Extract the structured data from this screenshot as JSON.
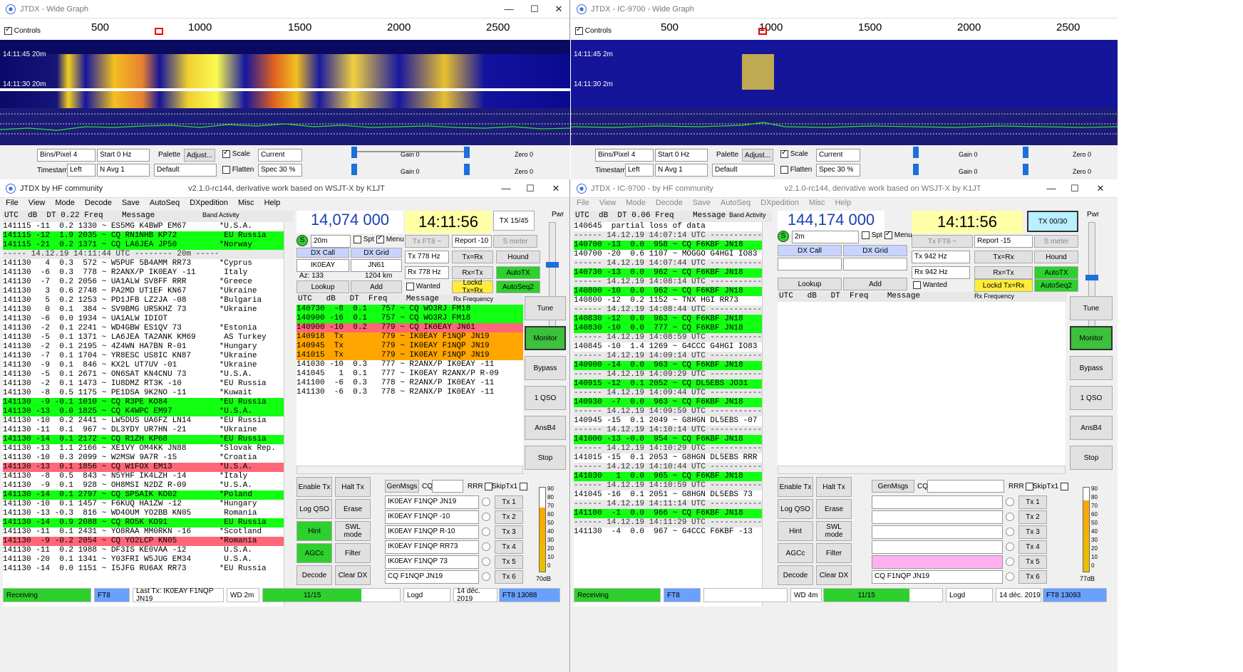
{
  "left_graph": {
    "title": "JTDX - Wide Graph",
    "controls_label": "Controls",
    "scale": [
      "500",
      "1000",
      "1500",
      "2000",
      "2500"
    ],
    "ts1": "14:11:45  20m",
    "ts2": "14:11:30  20m",
    "bins_label": "Bins/Pixel",
    "bins_val": "4",
    "start_val": "Start 0 Hz",
    "palette": "Palette",
    "adjust": "Adjust...",
    "scale_cb": "Scale",
    "current": "Current",
    "gain1": "Gain 0",
    "zero1": "Zero 0",
    "timestamp": "Timestamp",
    "left": "Left",
    "navg": "N Avg 1",
    "default": "Default",
    "flatten": "Flatten",
    "spec": "Spec 30 %",
    "gain2": "Gain 0",
    "zero2": "Zero 0"
  },
  "right_graph": {
    "title": "JTDX - IC-9700 - Wide Graph",
    "controls_label": "Controls",
    "scale": [
      "500",
      "1000",
      "1500",
      "2000",
      "2500"
    ],
    "ts1": "14:11:45  2m",
    "ts2": "14:11:30  2m",
    "bins_label": "Bins/Pixel",
    "bins_val": "4",
    "start_val": "Start 0 Hz",
    "palette": "Palette",
    "adjust": "Adjust...",
    "scale_cb": "Scale",
    "current": "Current",
    "gain1": "Gain 0",
    "zero1": "Zero 0",
    "timestamp": "Timestamp",
    "left": "Left",
    "navg": "N Avg 1",
    "default": "Default",
    "flatten": "Flatten",
    "spec": "Spec 30 %",
    "gain2": "Gain 0",
    "zero2": "Zero 0"
  },
  "left_main": {
    "title": "JTDX  by HF community",
    "subtitle": "v2.1.0-rc144, derivative work based on WSJT-X by K1JT",
    "menu": [
      "File",
      "View",
      "Mode",
      "Decode",
      "Save",
      "AutoSeq",
      "DXpedition",
      "Misc",
      "Help"
    ],
    "band_header": "UTC  dB  DT 0.22 Freq    Message",
    "band_activity": "Band Activity",
    "band_rows": [
      {
        "t": "141115 -11  0.2 1330 ~ ES5MG K4BWP EM67       *U.S.A.",
        "c": ""
      },
      {
        "t": "141115 -12  1.9 2035 ~ CQ RN1NHB KP72          EU Russia",
        "c": "g"
      },
      {
        "t": "141115 -21  0.2 1371 ~ CQ LA6JEA JP50         *Norway",
        "c": "g"
      },
      {
        "t": "----- 14.12.19 14:11:44 UTC -------- 20m -----",
        "c": "h"
      },
      {
        "t": "141130   4  0.3  572 ~ W5PUF 5B4AMM RR73      *Cyprus",
        "c": ""
      },
      {
        "t": "141130  -6  0.3  778 ~ R2ANX/P IK0EAY -11      Italy",
        "c": ""
      },
      {
        "t": "141130  -7  0.2 2056 ~ UA1ALW SV8FF RRR       *Greece",
        "c": ""
      },
      {
        "t": "141130   3  0.6 2748 ~ PA2MD UT1EF KN67       *Ukraine",
        "c": ""
      },
      {
        "t": "141130   5  0.2 1253 ~ PD1JFB LZ2JA -08       *Bulgaria",
        "c": ""
      },
      {
        "t": "141130   0  0.1  384 ~ SV9BMG UR5KHZ 73       *Ukraine",
        "c": ""
      },
      {
        "t": "141130  -6  0.0 1934 ~ UA1ALW IDIOT",
        "c": ""
      },
      {
        "t": "141130  -2  0.1 2241 ~ WD4GBW ES1QV 73        *Estonia",
        "c": ""
      },
      {
        "t": "141130  -5  0.1 1371 ~ LA6JEA TA2ANK KM69      AS Turkey",
        "c": ""
      },
      {
        "t": "141130  -2  0.1 2195 ~ 4Z4WN HA7BN R-01       *Hungary",
        "c": ""
      },
      {
        "t": "141130  -7  0.1 1704 ~ YR8ESC US8IC KN87      *Ukraine",
        "c": ""
      },
      {
        "t": "141130  -9  0.1  846 ~ KX2L UT7UV -01         *Ukraine",
        "c": ""
      },
      {
        "t": "141130  -5  0.1 2671 ~ ON6SAT KN4CNU 73       *U.S.A.",
        "c": ""
      },
      {
        "t": "141130  -2  0.1 1473 ~ IU8DMZ RT3K -10        *EU Russia",
        "c": ""
      },
      {
        "t": "141130  -8  0.5 1175 ~ PE1DSA 9K2NO -11       *Kuwait",
        "c": ""
      },
      {
        "t": "141130  -9 -0.1 1010 ~ CQ R3PE KO84           *EU Russia",
        "c": "g"
      },
      {
        "t": "141130 -13  0.0 1825 ~ CQ K4WPC EM97          *U.S.A.",
        "c": "g"
      },
      {
        "t": "141130 -10  0.2 2441 ~ LW5DUS UA6FZ LN14      *EU Russia",
        "c": ""
      },
      {
        "t": "141130 -11  0.1  967 ~ DL3YDY UR7HN -21       *Ukraine",
        "c": ""
      },
      {
        "t": "141130 -14  0.1 2172 ~ CQ R1ZH KP68           *EU Russia",
        "c": "g"
      },
      {
        "t": "141130 -13  1.1 2166 ~ XE1VY OM4KK JN88       *Slovak Rep.",
        "c": ""
      },
      {
        "t": "141130 -10  0.3 2099 ~ W2MSW 9A7R -15         *Croatia",
        "c": ""
      },
      {
        "t": "141130 -13  0.1 1856 ~ CQ W1FOX EM13          *U.S.A.",
        "c": "r"
      },
      {
        "t": "141130  -8  0.5  843 ~ N5YHF IK4LZH -14       *Italy",
        "c": ""
      },
      {
        "t": "141130  -9  0.1  928 ~ OH8MSI N2DZ R-09       *U.S.A.",
        "c": ""
      },
      {
        "t": "141130 -14  0.1 2797 ~ CQ SP5AIK KO02         *Poland",
        "c": "g"
      },
      {
        "t": "141130 -10  0.1 1457 ~ F6KUQ HA1ZW -12        *Hungary",
        "c": ""
      },
      {
        "t": "141130 -13 -0.3  816 ~ WD4OUM YO2BB KN05       Romania",
        "c": ""
      },
      {
        "t": "141130 -14  0.9 2088 ~ CQ RO5K KO91            EU Russia",
        "c": "g"
      },
      {
        "t": "141130 -11  0.1 2431 ~ YO8RAA MM0RKN -16      *Scotland",
        "c": ""
      },
      {
        "t": "141130  -9 -0.2 2054 ~ CQ YO2LCP KN05         *Romania",
        "c": "r"
      },
      {
        "t": "141130 -11  0.2 1988 ~ DF3IS KE0VAA -12        U.S.A.",
        "c": ""
      },
      {
        "t": "141130 -20  0.1 1341 ~ Y03FRI W5JUG EM34       U.S.A.",
        "c": ""
      },
      {
        "t": "141130 -14  0.0 1151 ~ I5JFG RU6AX RR73       *EU Russia",
        "c": ""
      }
    ],
    "freq": "14,074 000",
    "clock": "14:11:56",
    "tx_label": "TX 15/45",
    "band": "20m",
    "spt": "Spt",
    "menu_cb": "Menu",
    "tx_ft8": "Tx FT8 ~",
    "report": "Report -10",
    "smeter": "S meter",
    "dxcall_lbl": "DX Call",
    "dxgrid_lbl": "DX Grid",
    "dxcall": "IK0EAY",
    "dxgrid": "JN61",
    "tx_hz": "Tx  778 Hz",
    "txrx": "Tx=Rx",
    "hound": "Hound",
    "az": "Az: 133",
    "km": "1204 km",
    "rx_hz": "Rx  778 Hz",
    "rxtx": "Rx=Tx",
    "autotx": "AutoTX",
    "lookup": "Lookup",
    "add": "Add",
    "wanted": "Wanted",
    "lockd": "Lockd Tx=Rx",
    "autoseq2": "AutoSeq2",
    "pwr": "Pwr",
    "rx_header": "UTC   dB   DT  Freq    Message",
    "rx_freq_lbl": "Rx Frequency",
    "rx_rows": [
      {
        "t": "140730  -8  0.1   757 ~ CQ WO3RJ FM18",
        "c": "g"
      },
      {
        "t": "140900 -16  0.1   757 ~ CQ WO3RJ FM18",
        "c": "g"
      },
      {
        "t": "140900 -10  0.2   779 ~ CQ IK0EAY JN61",
        "c": "r"
      },
      {
        "t": "140918  Tx        779 ~ IK0EAY F1NQP JN19",
        "c": "o"
      },
      {
        "t": "140945  Tx        779 ~ IK0EAY F1NQP JN19",
        "c": "o"
      },
      {
        "t": "141015  Tx        779 ~ IK0EAY F1NQP JN19",
        "c": "o"
      },
      {
        "t": "141030 -10  0.3   777 ~ R2ANX/P IK0EAY -11",
        "c": ""
      },
      {
        "t": "141045   1  0.1   777 ~ IK0EAY R2ANX/P R-09",
        "c": ""
      },
      {
        "t": "141100  -6  0.3   778 ~ R2ANX/P IK0EAY -11",
        "c": ""
      },
      {
        "t": "141130  -6  0.3   778 ~ R2ANX/P IK0EAY -11",
        "c": ""
      }
    ],
    "side_btns": [
      "Tune",
      "Monitor",
      "Bypass",
      "1 QSO",
      "AnsB4",
      "Stop"
    ],
    "bottom_btns": [
      "Enable Tx",
      "Halt Tx",
      "Log QSO",
      "Erase",
      "Hint",
      "SWL mode",
      "AGCc",
      "Filter",
      "Decode",
      "Clear DX"
    ],
    "genmsgs": "GenMsgs",
    "cq": "CQ",
    "rrr": "RRR",
    "skiptx1": "SkipTx1",
    "msgs": [
      "IK0EAY F1NQP JN19",
      "IK0EAY F1NQP -10",
      "IK0EAY F1NQP R-10",
      "IK0EAY F1NQP RR73",
      "IK0EAY F1NQP 73",
      "CQ F1NQP JN19"
    ],
    "tx_btns": [
      "Tx 1",
      "Tx 2",
      "Tx 3",
      "Tx 4",
      "Tx 5",
      "Tx 6"
    ],
    "meter_ticks": [
      "90",
      "80",
      "70",
      "60",
      "50",
      "40",
      "30",
      "20",
      "10",
      "0"
    ],
    "meter_db": "70dB",
    "status": {
      "receiving": "Receiving",
      "mode": "FT8",
      "last_tx": "Last Tx: IK0EAY F1NQP JN19",
      "wd": "WD 2m",
      "progress": "11/15",
      "logd": "Logd",
      "date": "14 déc. 2019",
      "ft8n": "FT8  13088"
    }
  },
  "right_main": {
    "title": "JTDX - IC-9700 - by HF community",
    "subtitle": "v2.1.0-rc144, derivative work based on WSJT-X by K1JT",
    "menu": [
      "File",
      "View",
      "Mode",
      "Decode",
      "Save",
      "AutoSeq",
      "DXpedition",
      "Misc",
      "Help"
    ],
    "band_header": "UTC  dB  DT 0.06 Freq    Message",
    "band_activity": "Band Activity",
    "band_rows": [
      {
        "t": "140645  partial loss of data",
        "c": ""
      },
      {
        "t": "------ 14.12.19 14:07:14 UTC -----------",
        "c": "h"
      },
      {
        "t": "140700 -13  0.0  958 ~ CQ F6KBF JN18",
        "c": "g"
      },
      {
        "t": "140700 -20  0.6 1107 ~ MOGGO G4HGI IO83",
        "c": ""
      },
      {
        "t": "------ 14.12.19 14:07:44 UTC -----------",
        "c": "h"
      },
      {
        "t": "140730 -13  0.0  962 ~ CQ F6KBF JN18",
        "c": "g"
      },
      {
        "t": "------ 14.12.19 14:08:14 UTC -----------",
        "c": "h"
      },
      {
        "t": "140800 -10  0.0  962 ~ CQ F6KBF JN18",
        "c": "g"
      },
      {
        "t": "140800 -12  0.2 1152 ~ TNX HGI RR73",
        "c": ""
      },
      {
        "t": "------ 14.12.19 14:08:44 UTC -----------",
        "c": "h"
      },
      {
        "t": "140830 -12  0.0  963 ~ CQ F6KBF JN18",
        "c": "g"
      },
      {
        "t": "140830 -10  0.0  777 ~ CQ F6KBF JN18",
        "c": "g"
      },
      {
        "t": "------ 14.12.19 14:08:59 UTC -----------",
        "c": "h"
      },
      {
        "t": "140845 -10  1.4 1269 ~ G4CCC G4HGI IO83",
        "c": ""
      },
      {
        "t": "------ 14.12.19 14:09:14 UTC -----------",
        "c": "h"
      },
      {
        "t": "140900 -14  0.0  963 ~ CQ F6KBF JN18",
        "c": "g"
      },
      {
        "t": "------ 14.12.19 14:09:29 UTC -----------",
        "c": "h"
      },
      {
        "t": "140915 -12  0.1 2052 ~ CQ DL5EBS JO31",
        "c": "g"
      },
      {
        "t": "------ 14.12.19 14:09:44 UTC -----------",
        "c": "h"
      },
      {
        "t": "140930  -7  0.0  963 ~ CQ F6KBF JN18",
        "c": "g"
      },
      {
        "t": "------ 14.12.19 14:09:59 UTC -----------",
        "c": "h"
      },
      {
        "t": "140945 -15  0.1 2049 ~ G8HGN DL5EBS -07",
        "c": ""
      },
      {
        "t": "------ 14.12.19 14:10:14 UTC -----------",
        "c": "h"
      },
      {
        "t": "141000 -13 -0.0  954 ~ CQ F6KBF JN18",
        "c": "g"
      },
      {
        "t": "------ 14.12.19 14:10:29 UTC -----------",
        "c": "h"
      },
      {
        "t": "141015 -15  0.1 2053 ~ G8HGN DL5EBS RRR",
        "c": ""
      },
      {
        "t": "------ 14.12.19 14:10:44 UTC -----------",
        "c": "h"
      },
      {
        "t": "141030   1  0.0  965 ~ CQ F6KBF JN18",
        "c": "g"
      },
      {
        "t": "------ 14.12.19 14:10:59 UTC -----------",
        "c": "h"
      },
      {
        "t": "141045 -16  0.1 2051 ~ G8HGN DL5EBS 73",
        "c": ""
      },
      {
        "t": "------ 14.12.19 14:11:14 UTC -----------",
        "c": "h"
      },
      {
        "t": "141100  -1  0.0  966 ~ CQ F6KBF JN18",
        "c": "g"
      },
      {
        "t": "------ 14.12.19 14:11:29 UTC -----------",
        "c": "h"
      },
      {
        "t": "141130  -4  0.0  967 ~ G4CCC F6KBF -13",
        "c": ""
      }
    ],
    "freq": "144,174 000",
    "clock": "14:11:56",
    "tx_label": "TX 00/30",
    "band": "2m",
    "spt": "Spt",
    "menu_cb": "Menu",
    "tx_ft8": "Tx FT8 ~",
    "report": "Report -15",
    "smeter": "S meter",
    "dxcall_lbl": "DX Call",
    "dxgrid_lbl": "DX Grid",
    "tx_hz": "Tx  942 Hz",
    "txrx": "Tx=Rx",
    "hound": "Hound",
    "rx_hz": "Rx  942 Hz",
    "rxtx": "Rx=Tx",
    "autotx": "AutoTX",
    "lookup": "Lookup",
    "add": "Add",
    "wanted": "Wanted",
    "lockd": "Lockd Tx=Rx",
    "autoseq2": "AutoSeq2",
    "pwr": "Pwr",
    "rx_header": "UTC   dB   DT  Freq    Message",
    "rx_freq_lbl": "Rx Frequency",
    "side_btns": [
      "Tune",
      "Monitor",
      "Bypass",
      "1 QSO",
      "AnsB4",
      "Stop"
    ],
    "bottom_btns": [
      "Enable Tx",
      "Halt Tx",
      "Log QSO",
      "Erase",
      "Hint",
      "SWL mode",
      "AGCc",
      "Filter",
      "Decode",
      "Clear DX"
    ],
    "genmsgs": "GenMsgs",
    "cq": "CQ",
    "rrr": "RRR",
    "skiptx1": "SkipTx1",
    "msgs": [
      "",
      "",
      "",
      "",
      "",
      "CQ F1NQP JN19"
    ],
    "tx_btns": [
      "Tx 1",
      "Tx 2",
      "Tx 3",
      "Tx 4",
      "Tx 5",
      "Tx 6"
    ],
    "meter_ticks": [
      "90",
      "80",
      "70",
      "60",
      "50",
      "40",
      "30",
      "20",
      "10",
      "0"
    ],
    "meter_db": "77dB",
    "status": {
      "receiving": "Receiving",
      "mode": "FT8",
      "last_tx": "",
      "wd": "WD 4m",
      "progress": "11/15",
      "logd": "Logd",
      "date": "14 déc. 2019",
      "ft8n": "FT8  13093"
    }
  }
}
